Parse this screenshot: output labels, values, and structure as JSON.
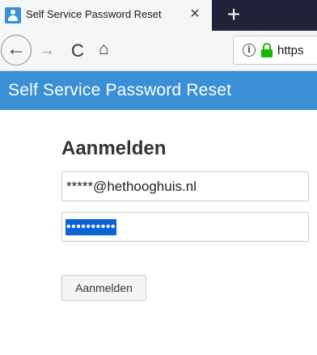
{
  "browser": {
    "tab_title": "Self Service Password Reset",
    "tab_close": "×",
    "new_tab": "+",
    "back": "←",
    "forward": "→",
    "reload": "C",
    "home": "⌂",
    "info": "i",
    "url_text": "https"
  },
  "site": {
    "header_title": "Self Service Password Reset"
  },
  "login": {
    "heading": "Aanmelden",
    "email_value": "*****@hethooghuis.nl",
    "password_value": "••••••••••",
    "submit_label": "Aanmelden"
  },
  "colors": {
    "header_bg": "#3a8fd6",
    "tabstrip_bg": "#20223a",
    "lock_green": "#12bc00",
    "selection_blue": "#0a63d6"
  }
}
